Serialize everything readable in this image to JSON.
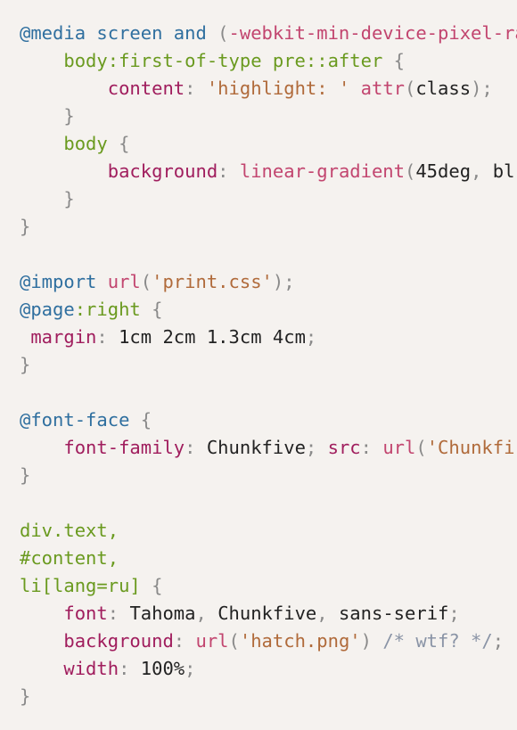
{
  "colors": {
    "background": "#f5f2ef",
    "at_rule": "#2f6f9f",
    "selector": "#6a9a1f",
    "property": "#a01d5d",
    "string": "#b06a3a",
    "function": "#c2456f",
    "punctuation": "#8a8a8a",
    "comment": "#8a94a6",
    "value": "#222222"
  },
  "lines": [
    [
      {
        "t": "@media screen and ",
        "c": "at_rule"
      },
      {
        "t": "(",
        "c": "punctuation"
      },
      {
        "t": "-webkit-min-device-pixel-ra",
        "c": "function"
      }
    ],
    [
      {
        "t": "    ",
        "c": "value"
      },
      {
        "t": "body:first-of-type pre::after",
        "c": "selector"
      },
      {
        "t": " {",
        "c": "punctuation"
      }
    ],
    [
      {
        "t": "        ",
        "c": "value"
      },
      {
        "t": "content",
        "c": "property"
      },
      {
        "t": ": ",
        "c": "punctuation"
      },
      {
        "t": "'highlight: '",
        "c": "string"
      },
      {
        "t": " ",
        "c": "value"
      },
      {
        "t": "attr",
        "c": "function"
      },
      {
        "t": "(",
        "c": "punctuation"
      },
      {
        "t": "class",
        "c": "value"
      },
      {
        "t": ");",
        "c": "punctuation"
      }
    ],
    [
      {
        "t": "    ",
        "c": "value"
      },
      {
        "t": "}",
        "c": "punctuation"
      }
    ],
    [
      {
        "t": "    ",
        "c": "value"
      },
      {
        "t": "body",
        "c": "selector"
      },
      {
        "t": " {",
        "c": "punctuation"
      }
    ],
    [
      {
        "t": "        ",
        "c": "value"
      },
      {
        "t": "background",
        "c": "property"
      },
      {
        "t": ": ",
        "c": "punctuation"
      },
      {
        "t": "linear-gradient",
        "c": "function"
      },
      {
        "t": "(",
        "c": "punctuation"
      },
      {
        "t": "45deg",
        "c": "value"
      },
      {
        "t": ", ",
        "c": "punctuation"
      },
      {
        "t": "bl",
        "c": "value"
      }
    ],
    [
      {
        "t": "    ",
        "c": "value"
      },
      {
        "t": "}",
        "c": "punctuation"
      }
    ],
    [
      {
        "t": "}",
        "c": "punctuation"
      }
    ],
    [],
    [
      {
        "t": "@import ",
        "c": "at_rule"
      },
      {
        "t": "url",
        "c": "function"
      },
      {
        "t": "(",
        "c": "punctuation"
      },
      {
        "t": "'print.css'",
        "c": "string"
      },
      {
        "t": ");",
        "c": "punctuation"
      }
    ],
    [
      {
        "t": "@page",
        "c": "at_rule"
      },
      {
        "t": ":right",
        "c": "selector"
      },
      {
        "t": " {",
        "c": "punctuation"
      }
    ],
    [
      {
        "t": " ",
        "c": "value"
      },
      {
        "t": "margin",
        "c": "property"
      },
      {
        "t": ": ",
        "c": "punctuation"
      },
      {
        "t": "1cm 2cm 1.3cm 4cm",
        "c": "value"
      },
      {
        "t": ";",
        "c": "punctuation"
      }
    ],
    [
      {
        "t": "}",
        "c": "punctuation"
      }
    ],
    [],
    [
      {
        "t": "@font-face",
        "c": "at_rule"
      },
      {
        "t": " {",
        "c": "punctuation"
      }
    ],
    [
      {
        "t": "    ",
        "c": "value"
      },
      {
        "t": "font-family",
        "c": "property"
      },
      {
        "t": ": ",
        "c": "punctuation"
      },
      {
        "t": "Chunkfive",
        "c": "value"
      },
      {
        "t": "; ",
        "c": "punctuation"
      },
      {
        "t": "src",
        "c": "property"
      },
      {
        "t": ": ",
        "c": "punctuation"
      },
      {
        "t": "url",
        "c": "function"
      },
      {
        "t": "(",
        "c": "punctuation"
      },
      {
        "t": "'Chunkfi",
        "c": "string"
      }
    ],
    [
      {
        "t": "}",
        "c": "punctuation"
      }
    ],
    [],
    [
      {
        "t": "div.text,",
        "c": "selector"
      }
    ],
    [
      {
        "t": "#content,",
        "c": "selector"
      }
    ],
    [
      {
        "t": "li[lang=ru]",
        "c": "selector"
      },
      {
        "t": " {",
        "c": "punctuation"
      }
    ],
    [
      {
        "t": "    ",
        "c": "value"
      },
      {
        "t": "font",
        "c": "property"
      },
      {
        "t": ": ",
        "c": "punctuation"
      },
      {
        "t": "Tahoma",
        "c": "value"
      },
      {
        "t": ", ",
        "c": "punctuation"
      },
      {
        "t": "Chunkfive",
        "c": "value"
      },
      {
        "t": ", ",
        "c": "punctuation"
      },
      {
        "t": "sans-serif",
        "c": "value"
      },
      {
        "t": ";",
        "c": "punctuation"
      }
    ],
    [
      {
        "t": "    ",
        "c": "value"
      },
      {
        "t": "background",
        "c": "property"
      },
      {
        "t": ": ",
        "c": "punctuation"
      },
      {
        "t": "url",
        "c": "function"
      },
      {
        "t": "(",
        "c": "punctuation"
      },
      {
        "t": "'hatch.png'",
        "c": "string"
      },
      {
        "t": ") ",
        "c": "punctuation"
      },
      {
        "t": "/* wtf? */",
        "c": "comment"
      },
      {
        "t": ";",
        "c": "punctuation"
      }
    ],
    [
      {
        "t": "    ",
        "c": "value"
      },
      {
        "t": "width",
        "c": "property"
      },
      {
        "t": ": ",
        "c": "punctuation"
      },
      {
        "t": "100%",
        "c": "value"
      },
      {
        "t": ";",
        "c": "punctuation"
      }
    ],
    [
      {
        "t": "}",
        "c": "punctuation"
      }
    ]
  ]
}
